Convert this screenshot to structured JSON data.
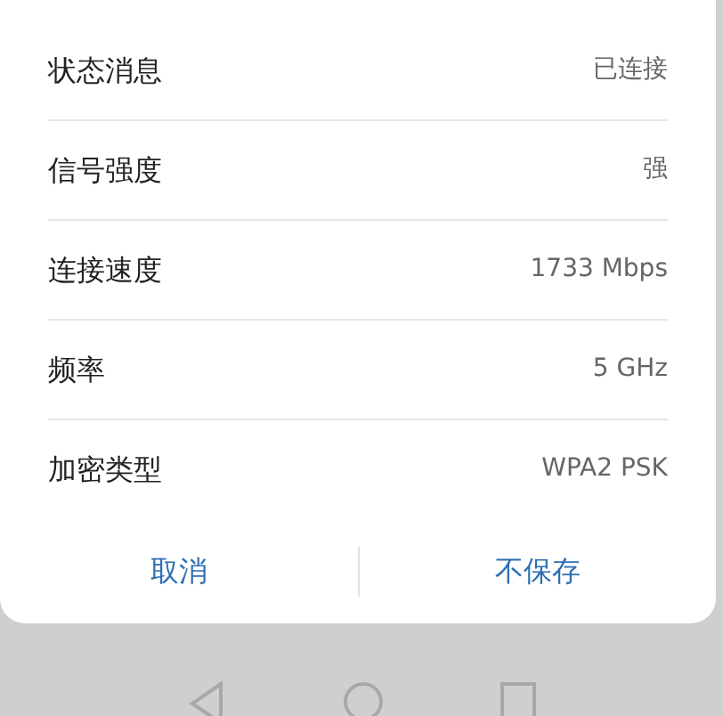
{
  "details": [
    {
      "label": "状态消息",
      "value": "已连接"
    },
    {
      "label": "信号强度",
      "value": "强"
    },
    {
      "label": "连接速度",
      "value": "1733 Mbps"
    },
    {
      "label": "频率",
      "value": "5 GHz"
    },
    {
      "label": "加密类型",
      "value": "WPA2 PSK"
    }
  ],
  "buttons": [
    "取消",
    "不保存"
  ]
}
